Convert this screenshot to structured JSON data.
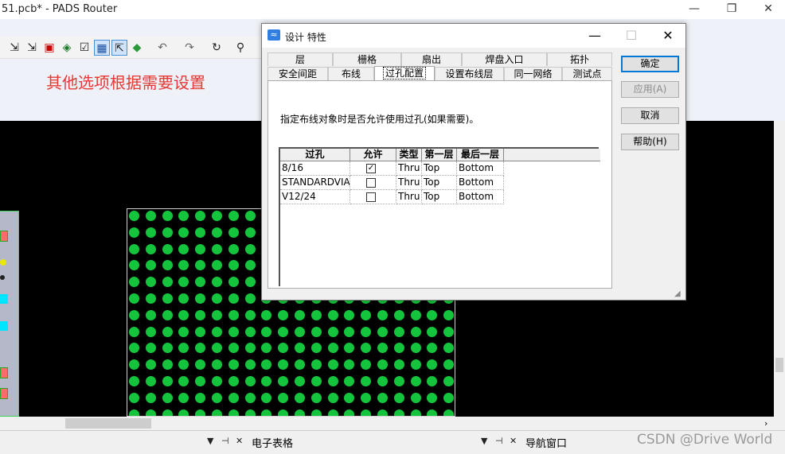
{
  "window": {
    "title": "51.pcb* - PADS Router",
    "controls": [
      "—",
      "❐",
      "✕"
    ]
  },
  "toolbar": {
    "icons": [
      "select-filter-icon",
      "drc-filter-icon",
      "highlight-icon",
      "layer-icon",
      "verify-icon",
      "route-icon",
      "interactive-route-icon",
      "auto-route-icon",
      "undo-icon",
      "redo-icon",
      "refresh-icon",
      "zoom-icon"
    ],
    "glyphs": [
      "⇲",
      "⇲",
      "▣",
      "◈",
      "☑",
      "▦",
      "⇱",
      "◆",
      "↶",
      "↷",
      "↻",
      "⚲"
    ]
  },
  "annotation": "其他选项根据需要设置",
  "dialog": {
    "title": "设计 特性",
    "controls": [
      "—",
      "☐",
      "✕"
    ],
    "tabs_row1": [
      "层",
      "栅格",
      "扇出",
      "焊盘入口",
      "拓扑"
    ],
    "tabs_row2": [
      "安全间距",
      "布线",
      "过孔配置",
      "设置布线层",
      "同一网络",
      "测试点"
    ],
    "selected_tab": "过孔配置",
    "instruction": "指定布线对象时是否允许使用过孔(如果需要)。",
    "table": {
      "headers": [
        "过孔",
        "允许",
        "类型",
        "第一层",
        "最后一层"
      ],
      "rows": [
        {
          "via": "8/16",
          "allowed": true,
          "type": "Thru",
          "first": "Top",
          "last": "Bottom"
        },
        {
          "via": "STANDARDVIA",
          "allowed": false,
          "type": "Thru",
          "first": "Top",
          "last": "Bottom"
        },
        {
          "via": "V12/24",
          "allowed": false,
          "type": "Thru",
          "first": "Top",
          "last": "Bottom"
        }
      ]
    },
    "buttons": {
      "ok": "确定",
      "apply": "应用(A)",
      "cancel": "取消",
      "help": "帮助(H)"
    }
  },
  "panels": {
    "spreadsheet": "电子表格",
    "navigator": "导航窗口",
    "controls": [
      "▼",
      "⊣",
      "✕"
    ]
  },
  "watermark": "CSDN @Drive World",
  "colors": {
    "pad": "#14c43c",
    "annotation": "#e53935",
    "canvas": "#000000",
    "accent": "#0078d7"
  }
}
